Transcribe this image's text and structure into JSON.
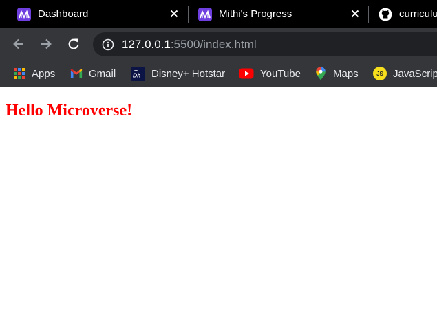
{
  "tabs": [
    {
      "title": "Dashboard",
      "favicon": "microverse-icon"
    },
    {
      "title": "Mithi's Progress",
      "favicon": "microverse-icon"
    },
    {
      "title": "curriculu",
      "favicon": "github-icon"
    }
  ],
  "toolbar": {
    "url_host": "127.0.0.1",
    "url_rest": ":5500/index.html"
  },
  "bookmarks": [
    {
      "label": "Apps",
      "icon": "apps-grid-icon"
    },
    {
      "label": "Gmail",
      "icon": "gmail-icon"
    },
    {
      "label": "Disney+ Hotstar",
      "icon": "hotstar-icon"
    },
    {
      "label": "YouTube",
      "icon": "youtube-icon"
    },
    {
      "label": "Maps",
      "icon": "maps-icon"
    },
    {
      "label": "JavaScript",
      "icon": "javascript-icon"
    }
  ],
  "page": {
    "heading": "Hello Microverse!",
    "heading_color": "#ff0000"
  },
  "colors": {
    "tab_bar": "#000000",
    "toolbar": "#35363a",
    "omnibox": "#202124",
    "microverse_brand": "#6f3fe0"
  }
}
